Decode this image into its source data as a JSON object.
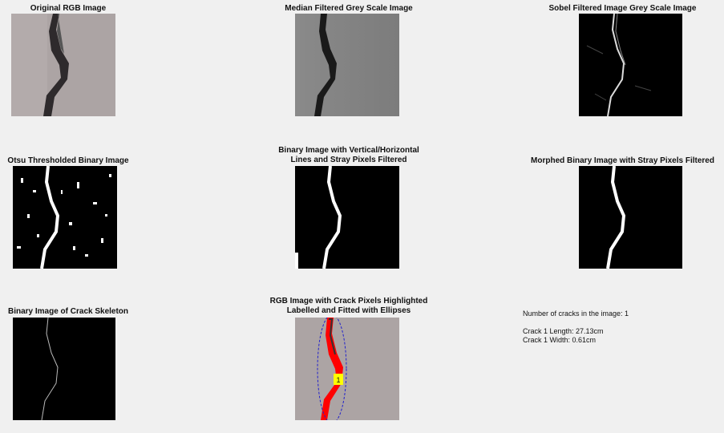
{
  "panels": {
    "p1": {
      "title": "Original RGB Image"
    },
    "p2": {
      "title": "Median Filtered Grey Scale Image"
    },
    "p3": {
      "title": "Sobel Filtered Image Grey Scale Image"
    },
    "p4": {
      "title": "Otsu Thresholded Binary Image"
    },
    "p5": {
      "title_line1": "Binary Image with Vertical/Horizontal",
      "title_line2": "Lines and Stray Pixels Filtered"
    },
    "p6": {
      "title": "Morphed Binary Image with Stray Pixels Filtered"
    },
    "p7": {
      "title": "Binary Image of Crack Skeleton"
    },
    "p8": {
      "title_line1": "RGB Image with Crack Pixels Highlighted",
      "title_line2": "Labelled and Fitted with Ellipses",
      "crack_label": "1"
    }
  },
  "results": {
    "count": "Number of cracks in the image: 1",
    "length": "Crack 1 Length: 27.13cm",
    "width": "Crack 1 Width: 0.61cm"
  },
  "colors": {
    "background": "#f0f0f0",
    "highlight": "#ff0000",
    "ellipse": "#2222cc",
    "label_box": "#ffff00"
  }
}
